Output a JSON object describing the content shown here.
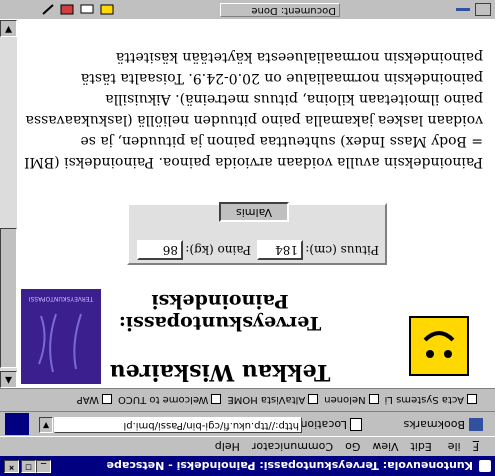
{
  "window": {
    "title": "Kuntoneuvola: Terveyskuntopassi: Painoindeksi - Netscape"
  },
  "menu": [
    "File",
    "Edit",
    "View",
    "Go",
    "Communicator",
    "Help"
  ],
  "menu_mnemonics": [
    "F",
    "E",
    "V",
    "G",
    "C",
    "H"
  ],
  "location_bar": {
    "bookmarks_label": "Bookmarks",
    "location_label": "Location:",
    "url": "http://ttp.uku.fi/cgi-bin/Passi/bmi.pl"
  },
  "personal_toolbar": [
    "Acta Systems Li",
    "Nelonen",
    "AltaVista HOME",
    "Welcome to TUCO",
    "WAP"
  ],
  "page": {
    "heading": "Tekkau Wiskaireu",
    "subheading_1": "Terveyskuntopassi:",
    "subheading_2": "Painoindeksi",
    "image_text": "TERVEYSKUNTOPASSI",
    "form": {
      "height_label": "Pituus (cm):",
      "height_value": "184",
      "weight_label": "Paino (kg):",
      "weight_value": "86",
      "submit_label": "Valmis"
    },
    "paragraph": "Painoindeksin avulla voidaan arvioida painoa. Painoindeksi (BMI = Body Mass Index) suhteuttaa painon ja pituuden, ja se voidaan laskea jakamalla paino pituuden neliöllä (laskukaavassa paino ilmoitetaan kiloina, pituus metreinä). Aikuisilla painoindeksin normaalialue on 20.0-24.9. Toisaalta tästä painoindeksin normaalialueesta käytetään käsitettä"
  },
  "status": {
    "text": "Document: Done"
  },
  "colors": {
    "titlebar": "#000080",
    "chrome": "#c0c0c0",
    "smiley": "#ffd800",
    "book": "#3c1f8e"
  }
}
